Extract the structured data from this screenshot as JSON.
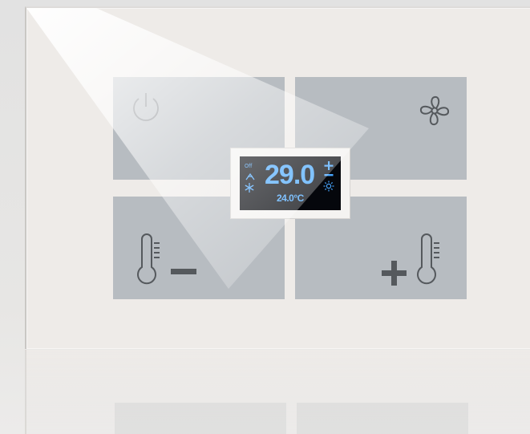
{
  "thermostat": {
    "buttons": {
      "power": {
        "icon": "power-icon"
      },
      "fan": {
        "icon": "fan-icon"
      },
      "temp_down": {
        "icon": "thermometer-minus-icon"
      },
      "temp_up": {
        "icon": "thermometer-plus-icon"
      }
    },
    "display": {
      "mode_label": "Off",
      "current_temperature": "29.0",
      "set_point": "24.0°C",
      "indicators": [
        "plus-icon",
        "minus-icon",
        "sun-icon",
        "fan-speed-icon",
        "snowflake-icon"
      ]
    },
    "colors": {
      "button_gray": "#b7bcc1",
      "icon_gray": "#55595d",
      "display_text_blue": "#48a6ff",
      "display_bg": "#05070c",
      "panel": "#eeebe8"
    }
  }
}
